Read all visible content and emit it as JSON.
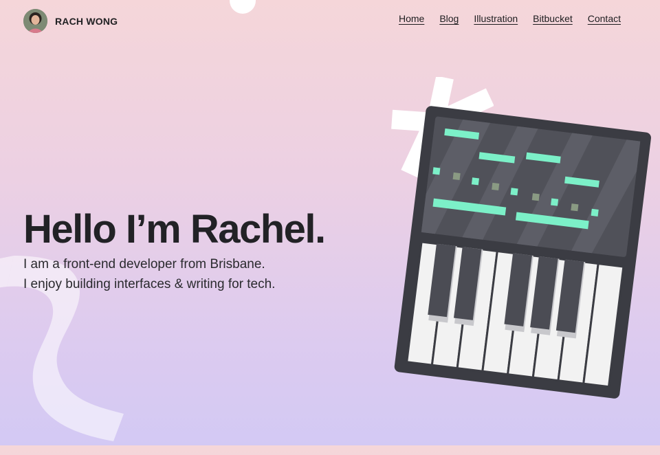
{
  "header": {
    "brand": "RACH WONG",
    "avatar_icon": "avatar-photo"
  },
  "nav": {
    "items": [
      "Home",
      "Blog",
      "Illustration",
      "Bitbucket",
      "Contact"
    ]
  },
  "hero": {
    "title": "Hello I’m Rachel.",
    "line1": "I am a front-end developer from Brisbane.",
    "line2": "I enjoy building interfaces & writing for tech."
  },
  "illustration": {
    "name": "synthesizer-keyboard",
    "screen_color": "#505159",
    "accent_color": "#7cf0c8"
  },
  "colors": {
    "background_top": "#f5d6d9",
    "background_bottom": "#d3c9f4",
    "text": "#212123"
  }
}
